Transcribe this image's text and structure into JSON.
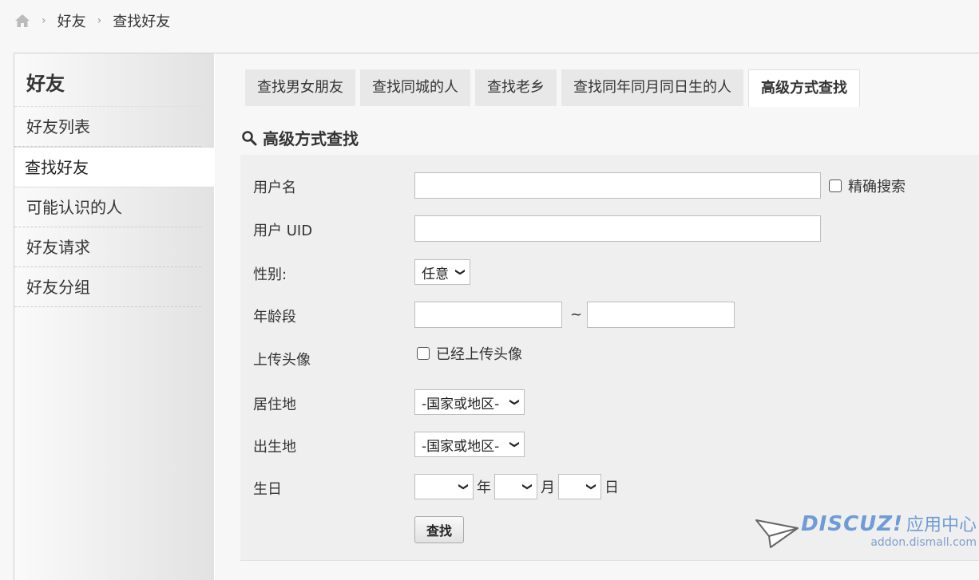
{
  "breadcrumb": {
    "home_icon": "home-icon",
    "items": [
      "好友",
      "查找好友"
    ]
  },
  "sidebar": {
    "title": "好友",
    "items": [
      {
        "label": "好友列表",
        "active": false
      },
      {
        "label": "查找好友",
        "active": true
      },
      {
        "label": "可能认识的人",
        "active": false
      },
      {
        "label": "好友请求",
        "active": false
      },
      {
        "label": "好友分组",
        "active": false
      }
    ]
  },
  "tabs": [
    {
      "label": "查找男女朋友",
      "active": false
    },
    {
      "label": "查找同城的人",
      "active": false
    },
    {
      "label": "查找老乡",
      "active": false
    },
    {
      "label": "查找同年同月同日生的人",
      "active": false
    },
    {
      "label": "高级方式查找",
      "active": true
    }
  ],
  "section": {
    "icon": "search-icon",
    "title": "高级方式查找"
  },
  "form": {
    "username": {
      "label": "用户名",
      "value": "",
      "exact_label": "精确搜索",
      "exact_checked": false
    },
    "uid": {
      "label": "用户 UID",
      "value": ""
    },
    "gender": {
      "label": "性别:",
      "selected": "任意"
    },
    "age": {
      "label": "年龄段",
      "from": "",
      "to": "",
      "separator": "~"
    },
    "avatar": {
      "label": "上传头像",
      "checkbox_label": "已经上传头像",
      "checked": false
    },
    "residence": {
      "label": "居住地",
      "selected": "-国家或地区-"
    },
    "birthplace": {
      "label": "出生地",
      "selected": "-国家或地区-"
    },
    "birthday": {
      "label": "生日",
      "year_unit": "年",
      "month_unit": "月",
      "day_unit": "日",
      "year": "",
      "month": "",
      "day": ""
    },
    "submit_label": "查找"
  },
  "watermark": {
    "logo": "DISCUZ!",
    "cn": "应用中心",
    "url": "addon.dismall.com"
  },
  "colors": {
    "watermark": "#6f9bd6",
    "accent": "#333333"
  }
}
